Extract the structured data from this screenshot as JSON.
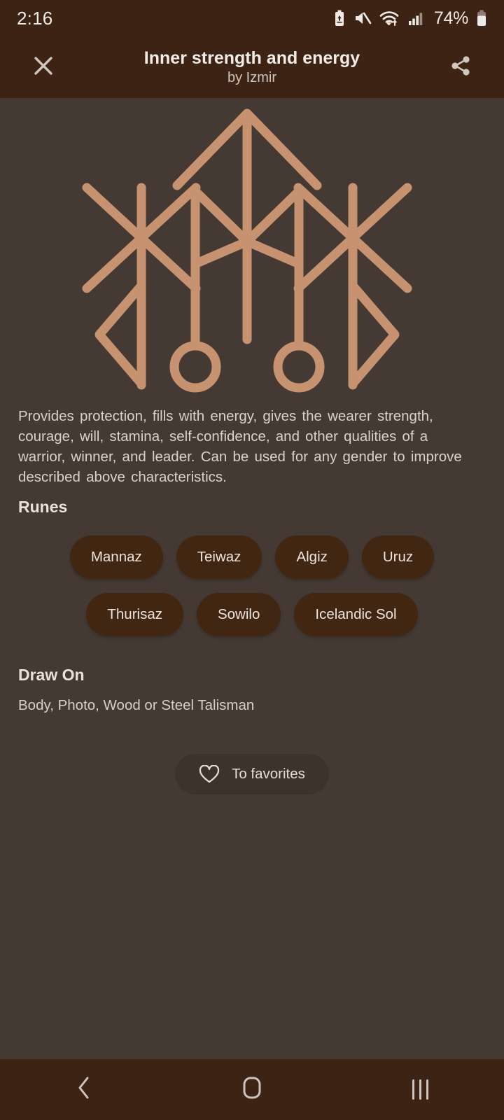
{
  "status_bar": {
    "time": "2:16",
    "battery_percent": "74%",
    "icons": [
      "battery-saver-icon",
      "mute-icon",
      "wifi-icon",
      "signal-icon",
      "battery-icon"
    ]
  },
  "app_bar": {
    "close_label": "close-icon",
    "title": "Inner strength and energy",
    "subtitle": "by Izmir",
    "share_label": "share-icon"
  },
  "artwork": {
    "name": "bind-rune-symbol",
    "stroke_color": "#C79270"
  },
  "content": {
    "description": "Provides protection,  fills with energy,  gives the wearer strength,  courage, will,  stamina,  self-confidence,  and other qualities of a warrior, winner, and leader.  Can be used for any gender to improve described above characteristics.",
    "runes_title": "Runes",
    "runes": [
      [
        "Mannaz",
        "Teiwaz",
        "Algiz",
        "Uruz"
      ],
      [
        "Thurisaz",
        "Sowilo",
        "Icelandic Sol"
      ]
    ],
    "draw_on_title": "Draw On",
    "draw_on_text": "Body, Photo, Wood or Steel Talisman",
    "favorites_label": "To favorites"
  },
  "nav_bar": {
    "back": "back-icon",
    "home": "home-icon",
    "recents": "recents-icon"
  },
  "colors": {
    "background": "#453A33",
    "bar": "#3C2313",
    "chip": "#412612",
    "accent": "#C79270",
    "text": "#E8E2DD"
  }
}
